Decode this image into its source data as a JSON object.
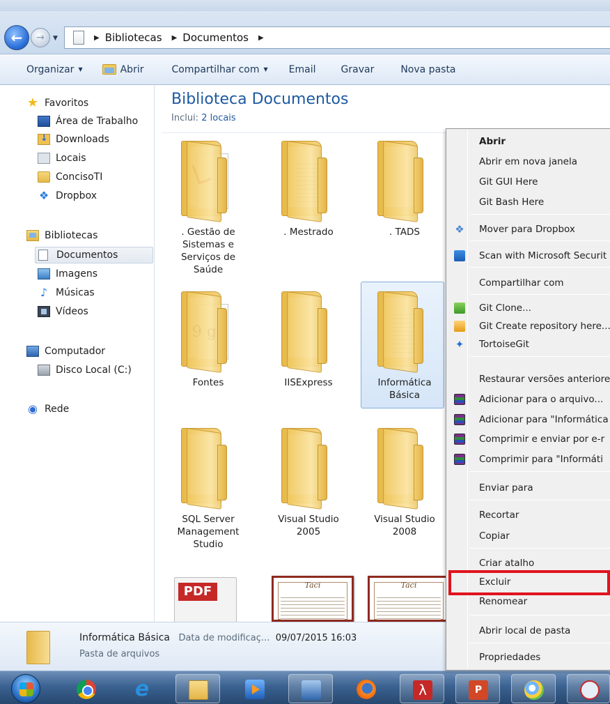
{
  "breadcrumb": [
    "Bibliotecas",
    "Documentos"
  ],
  "toolbar": {
    "organize": "Organizar",
    "open": "Abrir",
    "share": "Compartilhar com",
    "email": "Email",
    "burn": "Gravar",
    "new_folder": "Nova pasta"
  },
  "nav": {
    "favorites": "Favoritos",
    "desktop": "Área de Trabalho",
    "downloads": "Downloads",
    "places": "Locais",
    "conciso": "ConcisoTI",
    "dropbox": "Dropbox",
    "libraries": "Bibliotecas",
    "documents": "Documentos",
    "images": "Imagens",
    "music": "Músicas",
    "videos": "Vídeos",
    "computer": "Computador",
    "local_disk": "Disco Local (C:)",
    "network": "Rede"
  },
  "content": {
    "title": "Biblioteca Documentos",
    "includes_label": "Inclui:",
    "includes_link": "2 locais",
    "folders": [
      {
        "line1": ". Gestão de",
        "line2": "Sistemas e",
        "line3": "Serviços de",
        "line4": "Saúde"
      },
      {
        "line1": ". Mestrado"
      },
      {
        "line1": ". TADS"
      },
      {
        "line1": "Fontes"
      },
      {
        "line1": "IISExpress"
      },
      {
        "line1": "Informática",
        "line2": "Básica"
      },
      {
        "line1": "SQL Server",
        "line2": "Management",
        "line3": "Studio"
      },
      {
        "line1": "Visual Studio",
        "line2": "2005"
      },
      {
        "line1": "Visual Studio",
        "line2": "2008"
      }
    ],
    "pdf_badge": "PDF",
    "thumb_brand": "Taci"
  },
  "details": {
    "name": "Informática Básica",
    "modified_label": "Data de modificaç...",
    "modified_value": "09/07/2015 16:03",
    "type": "Pasta de arquivos"
  },
  "context_menu": {
    "open": "Abrir",
    "open_new_window": "Abrir em nova janela",
    "git_gui": "Git GUI Here",
    "git_bash": "Git Bash Here",
    "move_dropbox": "Mover para Dropbox",
    "scan": "Scan with Microsoft Securit",
    "share_with": "Compartilhar com",
    "git_clone": "Git Clone...",
    "git_create": "Git Create repository here...",
    "tortoise": "TortoiseGit",
    "restore": "Restaurar versões anteriore",
    "add_archive": "Adicionar para o arquivo...",
    "add_named": "Adicionar para \"Informática",
    "compress_email": "Comprimir e enviar por e-r",
    "compress_named": "Comprimir para \"Informáti",
    "send_to": "Enviar para",
    "cut": "Recortar",
    "copy": "Copiar",
    "create_shortcut": "Criar atalho",
    "delete": "Excluir",
    "rename": "Renomear",
    "open_location": "Abrir local de pasta",
    "properties": "Propriedades"
  },
  "colors": {
    "accent": "#1e5aa0",
    "highlight_box": "#e0141e"
  }
}
